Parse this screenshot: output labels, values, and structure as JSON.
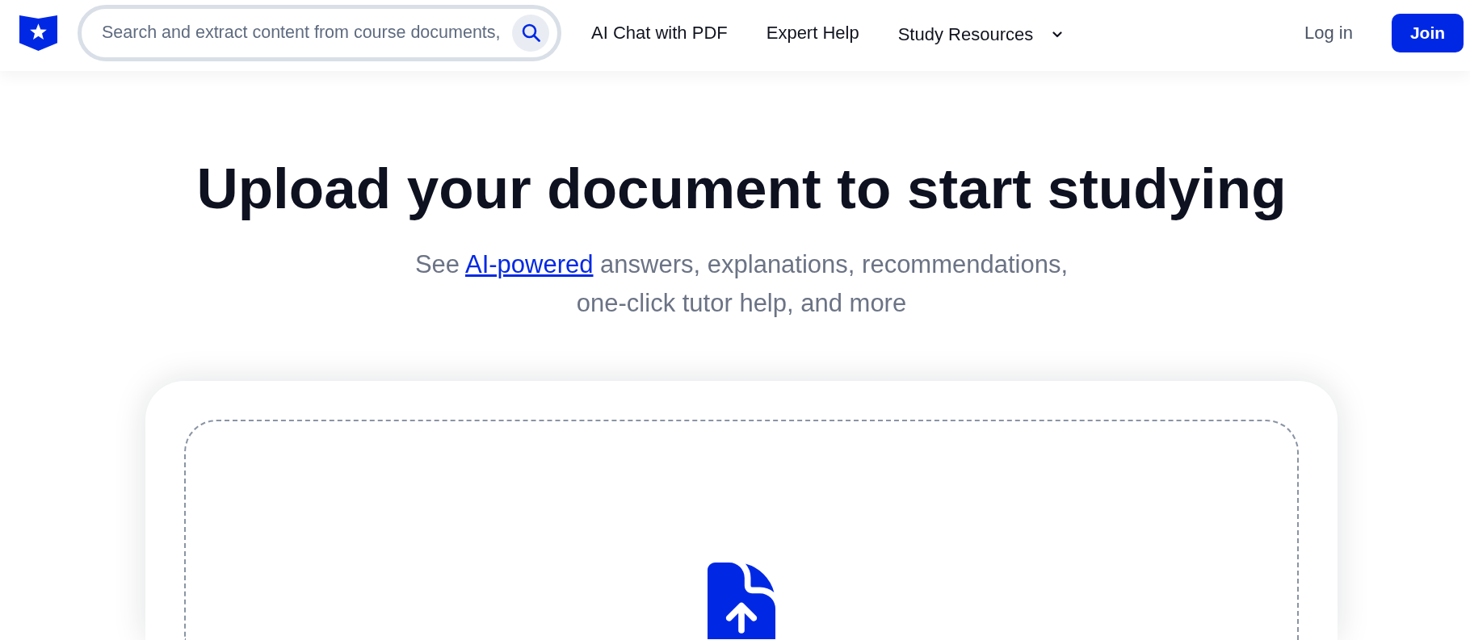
{
  "header": {
    "search": {
      "placeholder": "Search and extract content from course documents,"
    },
    "nav": [
      {
        "kind": "link",
        "label": "AI Chat with PDF"
      },
      {
        "kind": "link",
        "label": "Expert Help"
      },
      {
        "kind": "dropdown",
        "label": "Study Resources",
        "expanded": false
      }
    ],
    "login": "Log in",
    "join": "Join"
  },
  "hero": {
    "title": "Upload your document to start studying",
    "subtitle": {
      "before": "See",
      "link": "AI-powered",
      "after": "answers, explanations, recommendations, one-click tutor help, and more"
    }
  }
}
